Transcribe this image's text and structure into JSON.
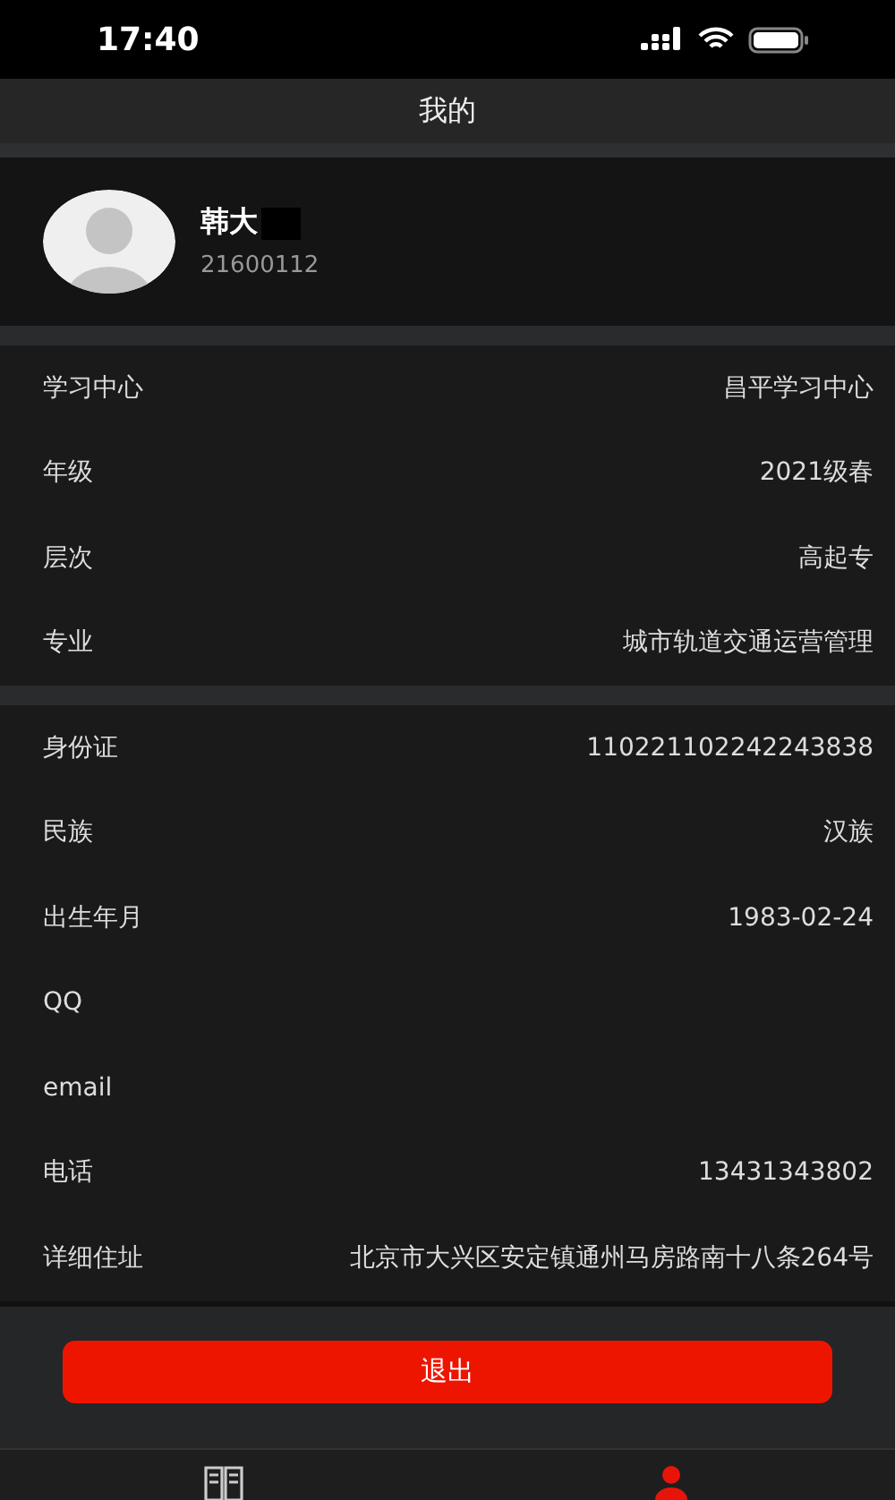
{
  "status_bar": {
    "time": "17:40"
  },
  "header": {
    "title": "我的"
  },
  "profile": {
    "name": "韩大",
    "redacted": true,
    "student_id": "21600112"
  },
  "sections": [
    {
      "rows": [
        {
          "label": "学习中心",
          "value": "昌平学习中心"
        },
        {
          "label": "年级",
          "value": "2021级春"
        },
        {
          "label": "层次",
          "value": "高起专"
        },
        {
          "label": "专业",
          "value": "城市轨道交通运营管理"
        }
      ]
    },
    {
      "rows": [
        {
          "label": "身份证",
          "value": "110221102242243838"
        },
        {
          "label": "民族",
          "value": "汉族"
        },
        {
          "label": "出生年月",
          "value": "1983-02-24"
        },
        {
          "label": "QQ",
          "value": ""
        },
        {
          "label": "email",
          "value": ""
        },
        {
          "label": "电话",
          "value": "13431343802"
        },
        {
          "label": "详细住址",
          "value": "北京市大兴区安定镇通州马房路南十八条264号"
        }
      ]
    }
  ],
  "logout_button": {
    "label": "退出"
  },
  "tab_bar": [
    {
      "kind": "book",
      "selected": false
    },
    {
      "kind": "person",
      "selected": true
    }
  ]
}
